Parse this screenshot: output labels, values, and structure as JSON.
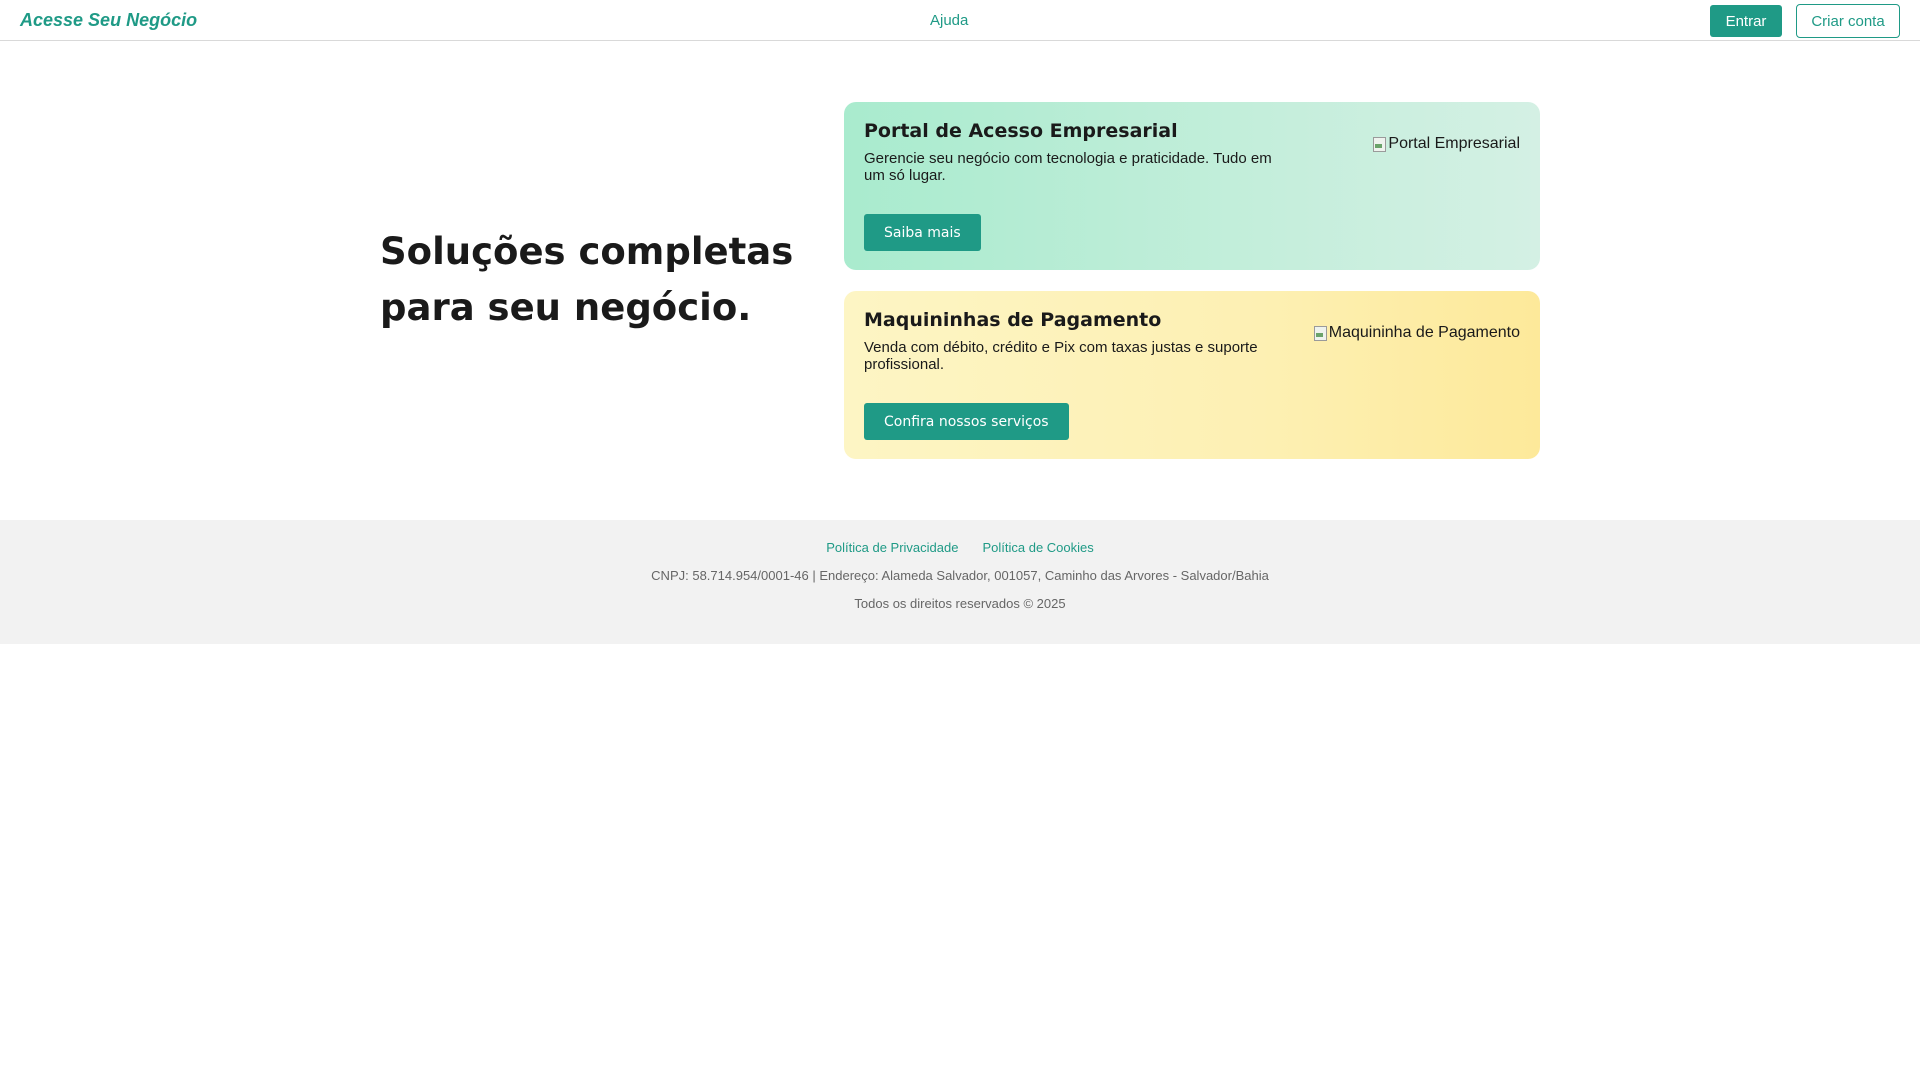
{
  "header": {
    "brand": "Acesse Seu Negócio",
    "help_link": "Ajuda",
    "login_button": "Entrar",
    "signup_button": "Criar conta"
  },
  "hero": {
    "title": "Soluções completas para seu negócio."
  },
  "cards": [
    {
      "title": "Portal de Acesso Empresarial",
      "text": "Gerencie seu negócio com tecnologia e praticidade. Tudo em um só lugar.",
      "button": "Saiba mais",
      "image_alt": "Portal Empresarial",
      "image_icon": "broken-image-icon"
    },
    {
      "title": "Maquininhas de Pagamento",
      "text": "Venda com débito, crédito e Pix com taxas justas e suporte profissional.",
      "button": "Confira nossos serviços",
      "image_alt": "Maquininha de Pagamento",
      "image_icon": "broken-image-icon"
    }
  ],
  "footer": {
    "links": [
      "Política de Privacidade",
      "Política de Cookies"
    ],
    "info": "CNPJ: 58.714.954/0001-46 | Endereço: Alameda Salvador, 001057, Caminho das Arvores - Salvador/Bahia",
    "copyright": "Todos os direitos reservados © 2025"
  },
  "colors": {
    "accent": "#1f9a86",
    "card1_bg": "#c4eedb",
    "card2_bg": "#fdf0b3",
    "footer_bg": "#f2f2f2"
  }
}
